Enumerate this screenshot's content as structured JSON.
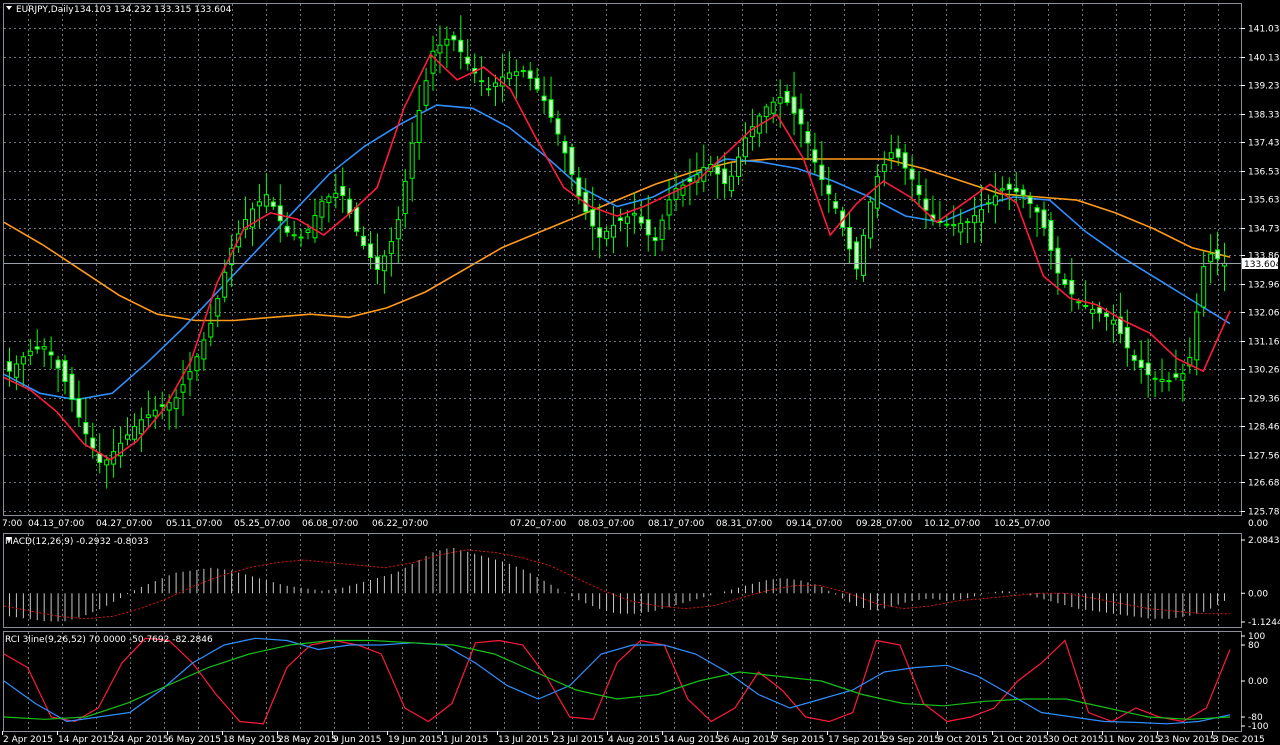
{
  "header": {
    "symbol": "EURJPY,Daily",
    "ohlc": "134.103 134.232 133.315 133.604"
  },
  "colors": {
    "background": "#000000",
    "grid": "#6e7680",
    "candle_up": "#000000",
    "candle_down": "#ccffcc",
    "candle_wick": "#00ff00",
    "ma_fast": "#ff1a3a",
    "ma_mid": "#2f8fff",
    "ma_slow": "#ff9a1a",
    "macd_hist": "#c8c8c8",
    "macd_signal": "#e01010",
    "rci_short": "#ff1a3a",
    "rci_mid": "#2f8fff",
    "rci_long": "#18c018"
  },
  "price_axis": {
    "labels": [
      "141.035",
      "140.135",
      "139.235",
      "138.335",
      "137.435",
      "136.535",
      "135.635",
      "134.735",
      "133.860",
      "132.960",
      "132.060",
      "131.160",
      "130.260",
      "129.360",
      "128.460",
      "127.560",
      "126.685",
      "125.785"
    ],
    "current_price": "133.604",
    "min": 125.785,
    "max": 141.035
  },
  "time_marker_labels": [
    "7:00",
    "04.13_07:00",
    "04.27_07:00",
    "05.11_07:00",
    "05.25_07:00",
    "06.08_07:00",
    "06.22_07:00",
    "07.20_07:00",
    "08.03_07:00",
    "08.17_07:00",
    "08.31_07:00",
    "09.14_07:00",
    "09.28_07:00",
    "10.12_07:00",
    "10.25_07:00"
  ],
  "date_axis": [
    "2 Apr 2015",
    "14 Apr 2015",
    "24 Apr 2015",
    "6 May 2015",
    "18 May 2015",
    "28 May 2015",
    "9 Jun 2015",
    "19 Jun 2015",
    "1 Jul 2015",
    "13 Jul 2015",
    "23 Jul 2015",
    "4 Aug 2015",
    "14 Aug 2015",
    "26 Aug 2015",
    "7 Sep 2015",
    "17 Sep 2015",
    "29 Sep 2015",
    "9 Oct 2015",
    "21 Oct 2015",
    "30 Oct 2015",
    "11 Nov 2015",
    "23 Nov 2015",
    "3 Dec 2015"
  ],
  "macd": {
    "label": "MACD(12,26,9) -0.2932 -0.8033",
    "axis": [
      "2.0843",
      "0.00",
      "-1.1244"
    ],
    "min": -1.1244,
    "max": 2.0843
  },
  "rci": {
    "label": "RCI 3line(9,26,52) 70.0000 -50.7692 -82.2846",
    "axis": [
      "100",
      "80",
      "0.00",
      "-80",
      "-100"
    ]
  },
  "chart_data": [
    {
      "type": "candlestick",
      "title": "EURJPY,Daily",
      "series_overlays": [
        "fast MA",
        "mid MA",
        "slow MA"
      ],
      "ylim": [
        125.785,
        141.035
      ],
      "close_approx": [
        130.2,
        130.8,
        131.0,
        129.9,
        128.4,
        127.2,
        127.9,
        128.6,
        129.0,
        129.3,
        130.4,
        131.8,
        134.0,
        135.2,
        135.8,
        134.6,
        134.4,
        135.6,
        135.9,
        134.4,
        133.4,
        134.6,
        137.8,
        140.3,
        140.8,
        139.8,
        139.1,
        139.6,
        139.7,
        138.8,
        137.4,
        135.6,
        134.4,
        134.9,
        135.2,
        134.2,
        135.9,
        136.2,
        136.8,
        136.0,
        137.6,
        138.5,
        138.9,
        138.0,
        136.4,
        135.2,
        133.4,
        136.2,
        137.2,
        136.3,
        135.0,
        134.8,
        134.9,
        135.4,
        136.0,
        135.8,
        135.1,
        133.2,
        132.4,
        132.1,
        131.8,
        130.6,
        130.0,
        129.9,
        130.2,
        134.0,
        133.6
      ],
      "ma_fast_approx": [
        130.0,
        129.6,
        128.9,
        127.9,
        127.4,
        128.0,
        129.0,
        130.5,
        133.0,
        134.7,
        135.2,
        135.0,
        134.5,
        135.2,
        136.0,
        138.5,
        140.2,
        139.4,
        139.8,
        139.1,
        137.5,
        136.0,
        135.4,
        135.1,
        135.4,
        135.8,
        136.2,
        137.0,
        137.8,
        138.3,
        136.9,
        134.5,
        135.5,
        136.2,
        135.7,
        134.9,
        135.5,
        136.1,
        135.5,
        133.2,
        132.5,
        132.3,
        131.8,
        131.4,
        130.6,
        130.2,
        132.1
      ],
      "ma_mid_approx": [
        130.1,
        129.5,
        129.3,
        129.5,
        130.5,
        131.6,
        132.8,
        134.0,
        135.2,
        136.4,
        137.3,
        138.0,
        138.6,
        138.5,
        137.9,
        137.0,
        136.0,
        135.4,
        135.7,
        136.3,
        136.9,
        136.8,
        136.6,
        136.2,
        135.7,
        135.1,
        134.9,
        135.4,
        135.7,
        135.6,
        134.6,
        133.8,
        133.1,
        132.4,
        131.7
      ],
      "ma_slow_approx": [
        134.9,
        134.2,
        133.4,
        132.6,
        132.0,
        131.8,
        131.8,
        131.9,
        132.0,
        131.9,
        132.2,
        132.7,
        133.4,
        134.1,
        134.6,
        135.1,
        135.6,
        136.1,
        136.5,
        136.8,
        136.9,
        136.9,
        136.9,
        136.9,
        136.6,
        136.2,
        135.8,
        135.7,
        135.6,
        135.2,
        134.7,
        134.1,
        133.8
      ]
    },
    {
      "type": "bar",
      "title": "MACD(12,26,9)",
      "ylim": [
        -1.1244,
        2.0843
      ],
      "histogram_approx": [
        -0.9,
        -1.0,
        -1.1,
        -1.1,
        -0.9,
        -0.6,
        -0.2,
        0.2,
        0.5,
        0.8,
        0.9,
        1.0,
        0.9,
        0.7,
        0.5,
        0.3,
        0.2,
        0.1,
        0.2,
        0.4,
        0.6,
        0.8,
        1.2,
        1.6,
        1.8,
        1.6,
        1.4,
        1.2,
        0.9,
        0.5,
        0.1,
        -0.3,
        -0.6,
        -0.8,
        -0.8,
        -0.7,
        -0.5,
        -0.3,
        -0.1,
        0.1,
        0.3,
        0.5,
        0.6,
        0.5,
        0.3,
        -0.1,
        -0.5,
        -0.7,
        -0.5,
        -0.3,
        -0.2,
        -0.3,
        -0.2,
        0.0,
        0.1,
        0.0,
        -0.2,
        -0.4,
        -0.6,
        -0.7,
        -0.8,
        -0.9,
        -1.0,
        -1.0,
        -0.9,
        -0.7,
        -0.3
      ],
      "signal_approx": [
        -0.5,
        -0.7,
        -0.9,
        -1.0,
        -0.9,
        -0.6,
        -0.2,
        0.3,
        0.7,
        1.0,
        1.2,
        1.3,
        1.2,
        1.1,
        1.0,
        1.2,
        1.5,
        1.7,
        1.6,
        1.4,
        1.1,
        0.6,
        0.1,
        -0.3,
        -0.5,
        -0.6,
        -0.5,
        -0.2,
        0.1,
        0.3,
        0.3,
        0.0,
        -0.4,
        -0.6,
        -0.5,
        -0.3,
        -0.2,
        -0.1,
        0.0,
        0.0,
        -0.2,
        -0.4,
        -0.6,
        -0.7,
        -0.8,
        -0.8
      ]
    },
    {
      "type": "line",
      "title": "RCI 3line(9,26,52)",
      "ylim": [
        -100,
        100
      ],
      "series": [
        {
          "values_approx": [
            60,
            30,
            -80,
            -90,
            -60,
            40,
            95,
            90,
            40,
            -30,
            -90,
            -95,
            30,
            80,
            90,
            80,
            60,
            -60,
            -90,
            -50,
            85,
            90,
            80,
            10,
            -80,
            -85,
            40,
            90,
            80,
            -40,
            -90,
            -60,
            20,
            -20,
            -80,
            -90,
            -70,
            90,
            80,
            -50,
            -90,
            -80,
            -60,
            0,
            40,
            90,
            -70,
            -90,
            -60,
            -80,
            -90,
            -60,
            70
          ]
        },
        {
          "values_approx": [
            0,
            -50,
            -90,
            -80,
            -70,
            -20,
            40,
            80,
            95,
            90,
            70,
            80,
            80,
            85,
            80,
            40,
            -10,
            -40,
            -10,
            60,
            80,
            80,
            60,
            20,
            -30,
            -60,
            -40,
            -20,
            20,
            30,
            35,
            10,
            -30,
            -70,
            -80,
            -90,
            -92,
            -95,
            -90,
            -75
          ]
        },
        {
          "values_approx": [
            -80,
            -85,
            -80,
            -50,
            -10,
            30,
            60,
            80,
            90,
            90,
            85,
            80,
            60,
            20,
            -20,
            -40,
            -30,
            0,
            20,
            10,
            0,
            -30,
            -50,
            -55,
            -45,
            -40,
            -40,
            -60,
            -80,
            -85,
            -80
          ]
        }
      ]
    }
  ]
}
